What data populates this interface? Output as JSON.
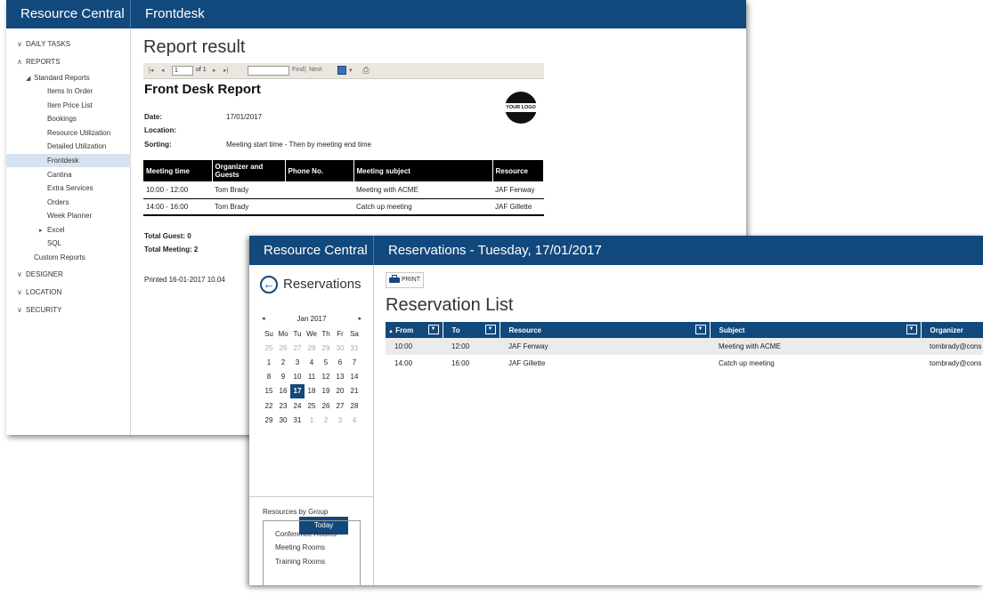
{
  "back_window": {
    "brand": "Resource Central",
    "title": "Frontdesk",
    "sidebar": {
      "daily_tasks": "DAILY TASKS",
      "reports": "REPORTS",
      "standard_reports": "Standard Reports",
      "items": [
        "Items In Order",
        "Item Price List",
        "Bookings",
        "Resource Utilization",
        "Detailed Utilization",
        "Frontdesk",
        "Cantina",
        "Extra Services",
        "Orders",
        "Week Planner"
      ],
      "excel": "Excel",
      "sql": "SQL",
      "custom_reports": "Custom Reports",
      "designer": "DESIGNER",
      "location": "LOCATION",
      "security": "SECURITY"
    },
    "report": {
      "page_title": "Report result",
      "toolbar": {
        "page_value": "1",
        "of_text": "of 1",
        "find_label": "Find",
        "sep": "|",
        "next_label": "Next"
      },
      "heading": "Front Desk Report",
      "logo_text": "YOUR LOGO",
      "date_label": "Date:",
      "date_value": "17/01/2017",
      "location_label": "Location:",
      "sorting_label": "Sorting:",
      "sorting_value": "Meeting start time - Then by meeting end time",
      "columns": [
        "Meeting time",
        "Organizer and Guests",
        "Phone No.",
        "Meeting subject",
        "Resource"
      ],
      "rows": [
        {
          "time": "10:00 - 12:00",
          "organizer": "Tom Brady",
          "phone": "",
          "subject": "Meeting with ACME",
          "resource": "JAF Fenway"
        },
        {
          "time": "14:00 - 16:00",
          "organizer": "Tom Brady",
          "phone": "",
          "subject": "Catch up meeting",
          "resource": "JAF Gillette"
        }
      ],
      "total_guest": "Total Guest: 0",
      "total_meeting": "Total Meeting: 2",
      "printed": "Printed 16-01-2017 10.04"
    }
  },
  "front_window": {
    "brand": "Resource Central",
    "title": "Reservations - Tuesday, 17/01/2017",
    "pane_title": "Reservations",
    "calendar": {
      "month": "Jan 2017",
      "weekdays": [
        "Su",
        "Mo",
        "Tu",
        "We",
        "Th",
        "Fr",
        "Sa"
      ],
      "weeks": [
        [
          "25",
          "26",
          "27",
          "28",
          "29",
          "30",
          "31"
        ],
        [
          "1",
          "2",
          "3",
          "4",
          "5",
          "6",
          "7"
        ],
        [
          "8",
          "9",
          "10",
          "11",
          "12",
          "13",
          "14"
        ],
        [
          "15",
          "16",
          "17",
          "18",
          "19",
          "20",
          "21"
        ],
        [
          "22",
          "23",
          "24",
          "25",
          "26",
          "27",
          "28"
        ],
        [
          "29",
          "30",
          "31",
          "1",
          "2",
          "3",
          "4"
        ]
      ],
      "selected": "17",
      "today_label": "Today"
    },
    "group_label": "Resources by Group",
    "groups": [
      "Conference Rooms",
      "Meeting Rooms",
      "Training Rooms"
    ],
    "print_label": "PRINT",
    "list_title": "Reservation List",
    "columns": [
      "From",
      "To",
      "Resource",
      "Subject",
      "Organizer"
    ],
    "sort_indicator": "▲",
    "filter_glyph": "▼",
    "rows": [
      {
        "from": "10:00",
        "to": "12:00",
        "resource": "JAF Fenway",
        "subject": "Meeting with ACME",
        "organizer": "tombrady@cons"
      },
      {
        "from": "14:00",
        "to": "16:00",
        "resource": "JAF Gillette",
        "subject": "Catch up meeting",
        "organizer": "tombrady@cons"
      }
    ]
  }
}
